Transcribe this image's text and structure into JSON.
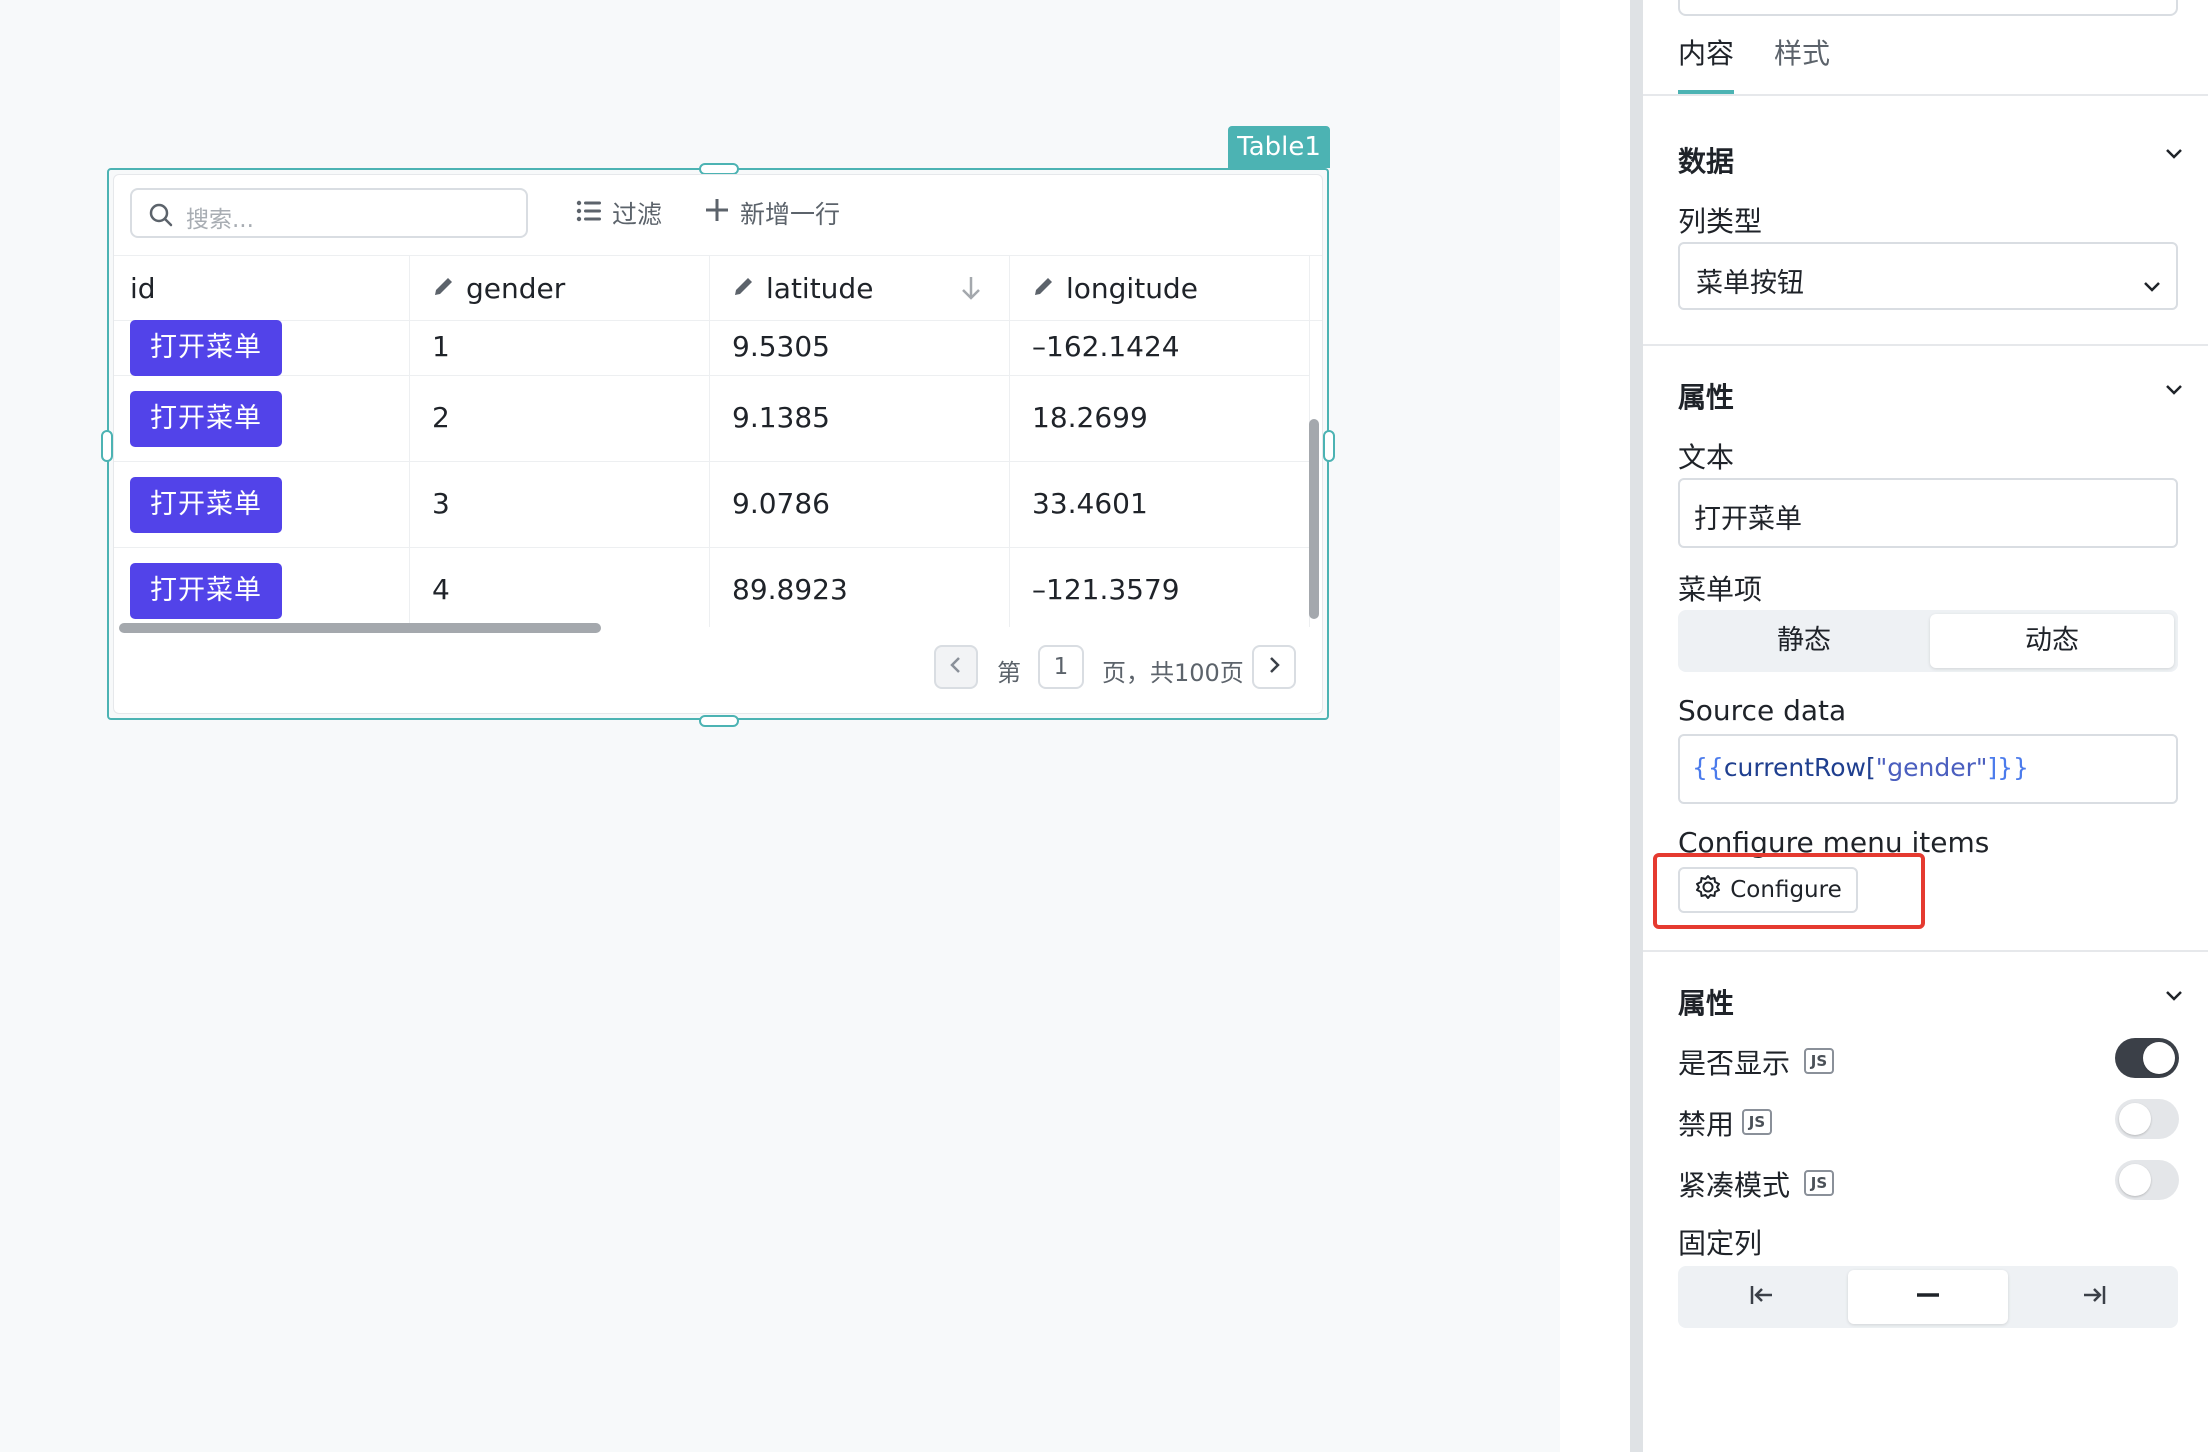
{
  "canvas": {
    "widget_name": "Table1",
    "table": {
      "search_placeholder": "搜索...",
      "filter_label": "过滤",
      "add_row_label": "新增一行",
      "columns": [
        "id",
        "gender",
        "latitude",
        "longitude"
      ],
      "rows": [
        {
          "button": "打开菜单",
          "gender": "1",
          "latitude": "9.5305",
          "longitude": "–162.1424"
        },
        {
          "button": "打开菜单",
          "gender": "2",
          "latitude": "9.1385",
          "longitude": "18.2699"
        },
        {
          "button": "打开菜单",
          "gender": "3",
          "latitude": "9.0786",
          "longitude": "33.4601"
        },
        {
          "button": "打开菜单",
          "gender": "4",
          "latitude": "89.8923",
          "longitude": "–121.3579"
        }
      ],
      "pager": {
        "prefix": "第",
        "page": "1",
        "suffix": "页，共100页"
      }
    }
  },
  "panel": {
    "tabs": [
      "内容",
      "样式"
    ],
    "active_tab": "内容",
    "data_section": {
      "title": "数据",
      "column_type_label": "列类型",
      "column_type_value": "菜单按钮"
    },
    "attr_section": {
      "title": "属性",
      "text_label": "文本",
      "text_value": "打开菜单",
      "menu_items_label": "菜单项",
      "menu_items_options": [
        "静态",
        "动态"
      ],
      "menu_items_selected": "动态",
      "source_data_label": "Source data",
      "source_data_open": "{{",
      "source_data_var": "currentRow[",
      "source_data_key": "\"gender\"",
      "source_data_close": "]}}",
      "configure_label": "Configure menu items",
      "configure_button": "Configure"
    },
    "props_section": {
      "title": "属性",
      "js_badge": "JS",
      "visible_label": "是否显示",
      "visible_on": true,
      "disabled_label": "禁用",
      "disabled_on": false,
      "compact_label": "紧凑模式",
      "compact_on": false,
      "fixed_column_label": "固定列",
      "fixed_column_selected": "none"
    },
    "colors": {
      "accent": "#4cb3b3",
      "primary_button": "#5243e9",
      "highlight": "#e53a30"
    }
  }
}
